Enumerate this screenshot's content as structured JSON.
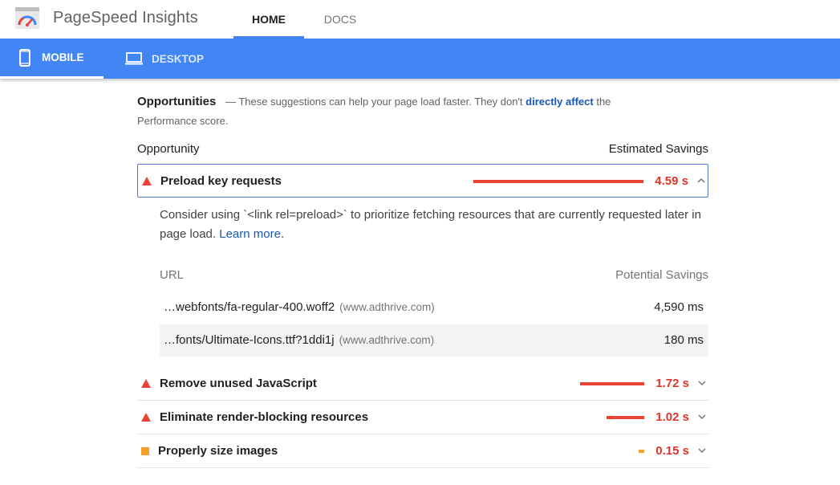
{
  "header": {
    "app_title": "PageSpeed Insights",
    "tabs": [
      {
        "label": "HOME",
        "active": true
      },
      {
        "label": "DOCS",
        "active": false
      }
    ],
    "logo_icon": "pagespeed-gauge-icon"
  },
  "device_bar": {
    "color": "#4285f4",
    "tabs": [
      {
        "label": "MOBILE",
        "icon": "smartphone-icon",
        "active": true
      },
      {
        "label": "DESKTOP",
        "icon": "laptop-icon",
        "active": false
      }
    ]
  },
  "opportunities": {
    "title": "Opportunities",
    "intro_pre": "— These suggestions can help your page load faster. They don't",
    "intro_link": "directly affect",
    "intro_post": "the Performance score.",
    "col_left": "Opportunity",
    "col_right": "Estimated Savings",
    "audits": [
      {
        "label": "Preload key requests",
        "value": "4.59 s",
        "severity": "fail",
        "marker_icon": "red-triangle-icon",
        "bar_fraction": 1.0,
        "expanded": true,
        "description_text": "Consider using `<link rel=preload>` to prioritize fetching resources that are currently requested later in page load.",
        "description_link": "Learn more",
        "table": {
          "col_url": "URL",
          "col_savings": "Potential Savings",
          "rows": [
            {
              "url": "…webfonts/fa-regular-400.woff2",
              "host": "(www.adthrive.com)",
              "savings": "4,590 ms"
            },
            {
              "url": "…fonts/Ultimate-Icons.ttf?1ddi1j",
              "host": "(www.adthrive.com)",
              "savings": "180 ms"
            }
          ]
        }
      },
      {
        "label": "Remove unused JavaScript",
        "value": "1.72 s",
        "severity": "fail",
        "marker_icon": "red-triangle-icon",
        "bar_fraction": 0.375,
        "expanded": false
      },
      {
        "label": "Eliminate render-blocking resources",
        "value": "1.02 s",
        "severity": "fail",
        "marker_icon": "red-triangle-icon",
        "bar_fraction": 0.222,
        "expanded": false
      },
      {
        "label": "Properly size images",
        "value": "0.15 s",
        "severity": "average",
        "marker_icon": "orange-square-icon",
        "bar_fraction": 0.033,
        "expanded": false
      }
    ]
  },
  "colors": {
    "fail": "#eb4335",
    "average": "#f4a029",
    "link": "#1a56b6"
  }
}
